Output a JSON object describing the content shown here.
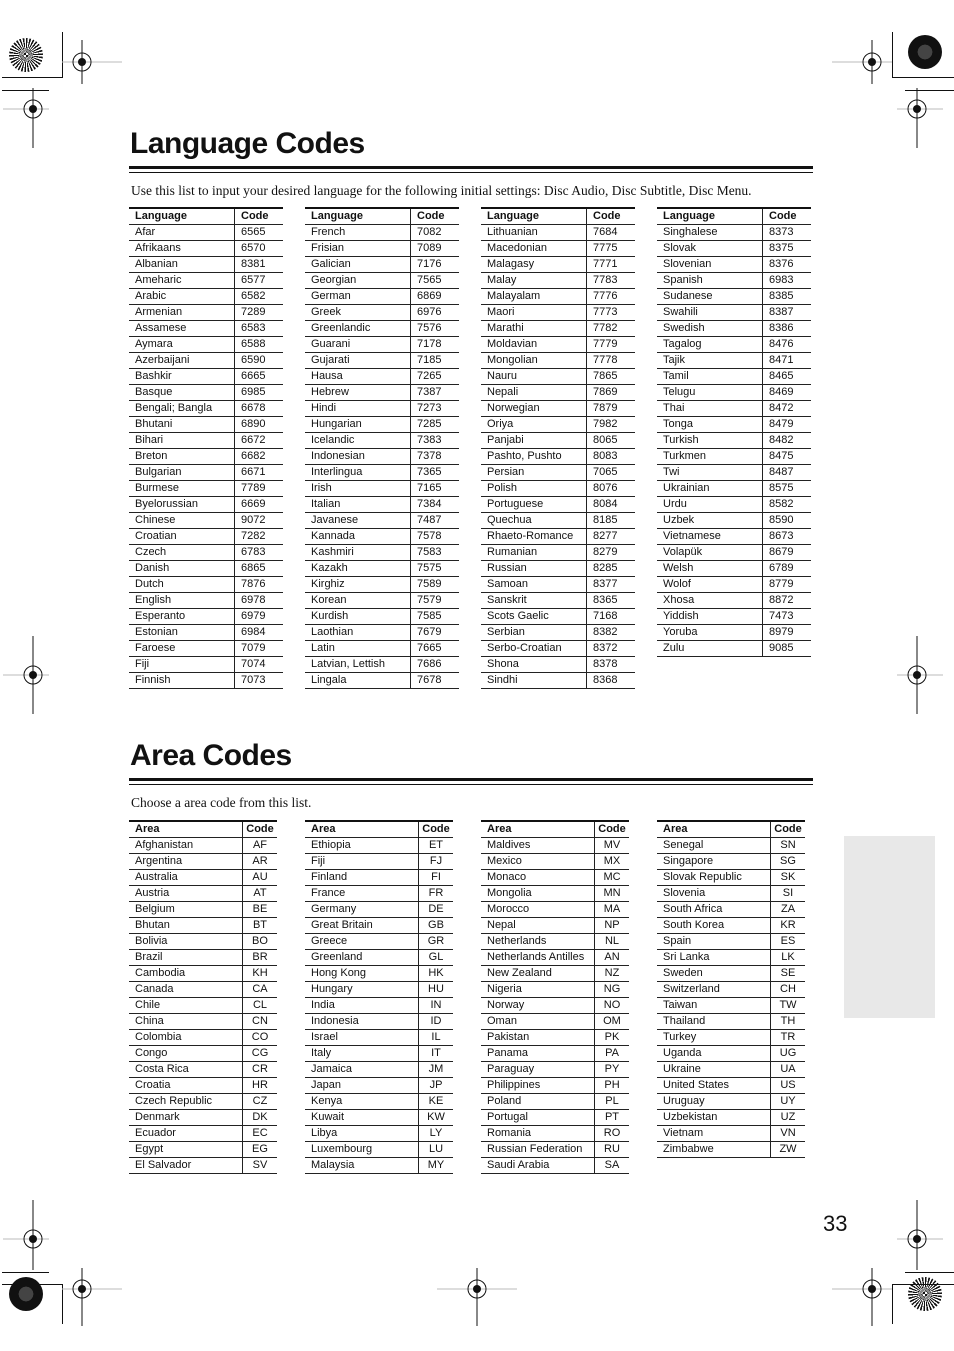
{
  "language_section": {
    "title": "Language Codes",
    "intro": "Use this list to input your desired language for the following initial settings: Disc Audio, Disc Subtitle, Disc Menu.",
    "header": {
      "name": "Language",
      "code": "Code"
    },
    "columns": [
      [
        [
          "Afar",
          "6565"
        ],
        [
          "Afrikaans",
          "6570"
        ],
        [
          "Albanian",
          "8381"
        ],
        [
          "Ameharic",
          "6577"
        ],
        [
          "Arabic",
          "6582"
        ],
        [
          "Armenian",
          "7289"
        ],
        [
          "Assamese",
          "6583"
        ],
        [
          "Aymara",
          "6588"
        ],
        [
          "Azerbaijani",
          "6590"
        ],
        [
          "Bashkir",
          "6665"
        ],
        [
          "Basque",
          "6985"
        ],
        [
          "Bengali; Bangla",
          "6678"
        ],
        [
          "Bhutani",
          "6890"
        ],
        [
          "Bihari",
          "6672"
        ],
        [
          "Breton",
          "6682"
        ],
        [
          "Bulgarian",
          "6671"
        ],
        [
          "Burmese",
          "7789"
        ],
        [
          "Byelorussian",
          "6669"
        ],
        [
          "Chinese",
          "9072"
        ],
        [
          "Croatian",
          "7282"
        ],
        [
          "Czech",
          "6783"
        ],
        [
          "Danish",
          "6865"
        ],
        [
          "Dutch",
          "7876"
        ],
        [
          "English",
          "6978"
        ],
        [
          "Esperanto",
          "6979"
        ],
        [
          "Estonian",
          "6984"
        ],
        [
          "Faroese",
          "7079"
        ],
        [
          "Fiji",
          "7074"
        ],
        [
          "Finnish",
          "7073"
        ]
      ],
      [
        [
          "French",
          "7082"
        ],
        [
          "Frisian",
          "7089"
        ],
        [
          "Galician",
          "7176"
        ],
        [
          "Georgian",
          "7565"
        ],
        [
          "German",
          "6869"
        ],
        [
          "Greek",
          "6976"
        ],
        [
          "Greenlandic",
          "7576"
        ],
        [
          "Guarani",
          "7178"
        ],
        [
          "Gujarati",
          "7185"
        ],
        [
          "Hausa",
          "7265"
        ],
        [
          "Hebrew",
          "7387"
        ],
        [
          "Hindi",
          "7273"
        ],
        [
          "Hungarian",
          "7285"
        ],
        [
          "Icelandic",
          "7383"
        ],
        [
          "Indonesian",
          "7378"
        ],
        [
          "Interlingua",
          "7365"
        ],
        [
          "Irish",
          "7165"
        ],
        [
          "Italian",
          "7384"
        ],
        [
          "Javanese",
          "7487"
        ],
        [
          "Kannada",
          "7578"
        ],
        [
          "Kashmiri",
          "7583"
        ],
        [
          "Kazakh",
          "7575"
        ],
        [
          "Kirghiz",
          "7589"
        ],
        [
          "Korean",
          "7579"
        ],
        [
          "Kurdish",
          "7585"
        ],
        [
          "Laothian",
          "7679"
        ],
        [
          "Latin",
          "7665"
        ],
        [
          "Latvian, Lettish",
          "7686"
        ],
        [
          "Lingala",
          "7678"
        ]
      ],
      [
        [
          "Lithuanian",
          "7684"
        ],
        [
          "Macedonian",
          "7775"
        ],
        [
          "Malagasy",
          "7771"
        ],
        [
          "Malay",
          "7783"
        ],
        [
          "Malayalam",
          "7776"
        ],
        [
          "Maori",
          "7773"
        ],
        [
          "Marathi",
          "7782"
        ],
        [
          "Moldavian",
          "7779"
        ],
        [
          "Mongolian",
          "7778"
        ],
        [
          "Nauru",
          "7865"
        ],
        [
          "Nepali",
          "7869"
        ],
        [
          "Norwegian",
          "7879"
        ],
        [
          "Oriya",
          "7982"
        ],
        [
          "Panjabi",
          "8065"
        ],
        [
          "Pashto, Pushto",
          "8083"
        ],
        [
          "Persian",
          "7065"
        ],
        [
          "Polish",
          "8076"
        ],
        [
          "Portuguese",
          "8084"
        ],
        [
          "Quechua",
          "8185"
        ],
        [
          "Rhaeto-Romance",
          "8277"
        ],
        [
          "Rumanian",
          "8279"
        ],
        [
          "Russian",
          "8285"
        ],
        [
          "Samoan",
          "8377"
        ],
        [
          "Sanskrit",
          "8365"
        ],
        [
          "Scots Gaelic",
          "7168"
        ],
        [
          "Serbian",
          "8382"
        ],
        [
          "Serbo-Croatian",
          "8372"
        ],
        [
          "Shona",
          "8378"
        ],
        [
          "Sindhi",
          "8368"
        ]
      ],
      [
        [
          "Singhalese",
          "8373"
        ],
        [
          "Slovak",
          "8375"
        ],
        [
          "Slovenian",
          "8376"
        ],
        [
          "Spanish",
          "6983"
        ],
        [
          "Sudanese",
          "8385"
        ],
        [
          "Swahili",
          "8387"
        ],
        [
          "Swedish",
          "8386"
        ],
        [
          "Tagalog",
          "8476"
        ],
        [
          "Tajik",
          "8471"
        ],
        [
          "Tamil",
          "8465"
        ],
        [
          "Telugu",
          "8469"
        ],
        [
          "Thai",
          "8472"
        ],
        [
          "Tonga",
          "8479"
        ],
        [
          "Turkish",
          "8482"
        ],
        [
          "Turkmen",
          "8475"
        ],
        [
          "Twi",
          "8487"
        ],
        [
          "Ukrainian",
          "8575"
        ],
        [
          "Urdu",
          "8582"
        ],
        [
          "Uzbek",
          "8590"
        ],
        [
          "Vietnamese",
          "8673"
        ],
        [
          "Volapük",
          "8679"
        ],
        [
          "Welsh",
          "6789"
        ],
        [
          "Wolof",
          "8779"
        ],
        [
          "Xhosa",
          "8872"
        ],
        [
          "Yiddish",
          "7473"
        ],
        [
          "Yoruba",
          "8979"
        ],
        [
          "Zulu",
          "9085"
        ]
      ]
    ]
  },
  "area_section": {
    "title": "Area Codes",
    "intro": "Choose a area code from this list.",
    "header": {
      "name": "Area",
      "code": "Code"
    },
    "columns": [
      [
        [
          "Afghanistan",
          "AF"
        ],
        [
          "Argentina",
          "AR"
        ],
        [
          "Australia",
          "AU"
        ],
        [
          "Austria",
          "AT"
        ],
        [
          "Belgium",
          "BE"
        ],
        [
          "Bhutan",
          "BT"
        ],
        [
          "Bolivia",
          "BO"
        ],
        [
          "Brazil",
          "BR"
        ],
        [
          "Cambodia",
          "KH"
        ],
        [
          "Canada",
          "CA"
        ],
        [
          "Chile",
          "CL"
        ],
        [
          "China",
          "CN"
        ],
        [
          "Colombia",
          "CO"
        ],
        [
          "Congo",
          "CG"
        ],
        [
          "Costa Rica",
          "CR"
        ],
        [
          "Croatia",
          "HR"
        ],
        [
          "Czech Republic",
          "CZ"
        ],
        [
          "Denmark",
          "DK"
        ],
        [
          "Ecuador",
          "EC"
        ],
        [
          "Egypt",
          "EG"
        ],
        [
          "El Salvador",
          "SV"
        ]
      ],
      [
        [
          "Ethiopia",
          "ET"
        ],
        [
          "Fiji",
          "FJ"
        ],
        [
          "Finland",
          "FI"
        ],
        [
          "France",
          "FR"
        ],
        [
          "Germany",
          "DE"
        ],
        [
          "Great Britain",
          "GB"
        ],
        [
          "Greece",
          "GR"
        ],
        [
          "Greenland",
          "GL"
        ],
        [
          "Hong Kong",
          "HK"
        ],
        [
          "Hungary",
          "HU"
        ],
        [
          "India",
          "IN"
        ],
        [
          "Indonesia",
          "ID"
        ],
        [
          "Israel",
          "IL"
        ],
        [
          "Italy",
          "IT"
        ],
        [
          "Jamaica",
          "JM"
        ],
        [
          "Japan",
          "JP"
        ],
        [
          "Kenya",
          "KE"
        ],
        [
          "Kuwait",
          "KW"
        ],
        [
          "Libya",
          "LY"
        ],
        [
          "Luxembourg",
          "LU"
        ],
        [
          "Malaysia",
          "MY"
        ]
      ],
      [
        [
          "Maldives",
          "MV"
        ],
        [
          "Mexico",
          "MX"
        ],
        [
          "Monaco",
          "MC"
        ],
        [
          "Mongolia",
          "MN"
        ],
        [
          "Morocco",
          "MA"
        ],
        [
          "Nepal",
          "NP"
        ],
        [
          "Netherlands",
          "NL"
        ],
        [
          "Netherlands Antilles",
          "AN"
        ],
        [
          "New Zealand",
          "NZ"
        ],
        [
          "Nigeria",
          "NG"
        ],
        [
          "Norway",
          "NO"
        ],
        [
          "Oman",
          "OM"
        ],
        [
          "Pakistan",
          "PK"
        ],
        [
          "Panama",
          "PA"
        ],
        [
          "Paraguay",
          "PY"
        ],
        [
          "Philippines",
          "PH"
        ],
        [
          "Poland",
          "PL"
        ],
        [
          "Portugal",
          "PT"
        ],
        [
          "Romania",
          "RO"
        ],
        [
          "Russian Federation",
          "RU"
        ],
        [
          "Saudi Arabia",
          "SA"
        ]
      ],
      [
        [
          "Senegal",
          "SN"
        ],
        [
          "Singapore",
          "SG"
        ],
        [
          "Slovak Republic",
          "SK"
        ],
        [
          "Slovenia",
          "SI"
        ],
        [
          "South Africa",
          "ZA"
        ],
        [
          "South Korea",
          "KR"
        ],
        [
          "Spain",
          "ES"
        ],
        [
          "Sri Lanka",
          "LK"
        ],
        [
          "Sweden",
          "SE"
        ],
        [
          "Switzerland",
          "CH"
        ],
        [
          "Taiwan",
          "TW"
        ],
        [
          "Thailand",
          "TH"
        ],
        [
          "Turkey",
          "TR"
        ],
        [
          "Uganda",
          "UG"
        ],
        [
          "Ukraine",
          "UA"
        ],
        [
          "United States",
          "US"
        ],
        [
          "Uruguay",
          "UY"
        ],
        [
          "Uzbekistan",
          "UZ"
        ],
        [
          "Vietnam",
          "VN"
        ],
        [
          "Zimbabwe",
          "ZW"
        ]
      ]
    ]
  },
  "page_number": "33",
  "colors": {
    "text": "#111111",
    "side_tab": "#e8e8e8"
  }
}
